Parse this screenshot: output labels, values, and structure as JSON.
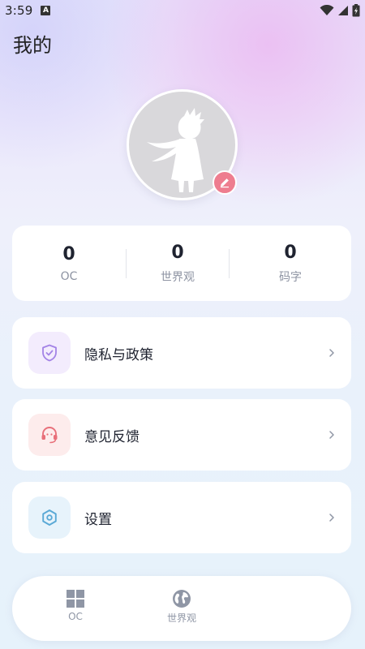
{
  "status_bar": {
    "time": "3:59",
    "notification_icon": "a-letter-icon",
    "icons": [
      "wifi-icon",
      "signal-icon",
      "battery-icon"
    ]
  },
  "page": {
    "title": "我的"
  },
  "avatar": {
    "icon": "little-prince-silhouette",
    "edit_icon": "pencil-icon",
    "accent": "#ee7d8f"
  },
  "stats": [
    {
      "value": "0",
      "label": "OC"
    },
    {
      "value": "0",
      "label": "世界观"
    },
    {
      "value": "0",
      "label": "码字"
    }
  ],
  "menu": [
    {
      "label": "隐私与政策",
      "icon": "shield-check-icon",
      "icon_bg": "#f3ecfd",
      "icon_color": "#a383e6"
    },
    {
      "label": "意见反馈",
      "icon": "headset-icon",
      "icon_bg": "#fdecec",
      "icon_color": "#e8707a"
    },
    {
      "label": "设置",
      "icon": "settings-icon",
      "icon_bg": "#e7f3fb",
      "icon_color": "#5aa9d6"
    }
  ],
  "tabbar": {
    "tabs": [
      {
        "label": "OC",
        "icon": "grid-icon"
      },
      {
        "label": "世界观",
        "icon": "globe-icon"
      }
    ]
  }
}
